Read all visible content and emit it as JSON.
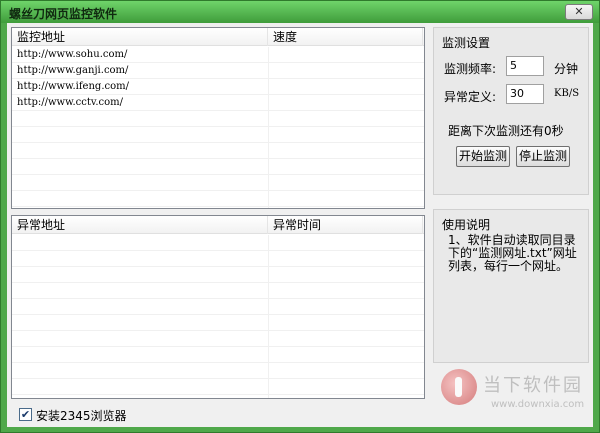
{
  "window": {
    "title": "螺丝刀网页监控软件",
    "close_glyph": "✕"
  },
  "monitor_list": {
    "headers": [
      "监控地址",
      "速度"
    ],
    "rows": [
      [
        "http://www.sohu.com/",
        ""
      ],
      [
        "http://www.ganji.com/",
        ""
      ],
      [
        "http://www.ifeng.com/",
        ""
      ],
      [
        "http://www.cctv.com/",
        ""
      ]
    ]
  },
  "exception_list": {
    "headers": [
      "异常地址",
      "异常时间"
    ],
    "rows": []
  },
  "settings": {
    "title": "监测设置",
    "frequency_label": "监测频率:",
    "frequency_value": "5",
    "frequency_unit": "分钟",
    "exception_label": "异常定义:",
    "exception_value": "30",
    "exception_unit": "KB/S",
    "countdown": "距离下次监测还有0秒",
    "start_button": "开始监测",
    "stop_button": "停止监测"
  },
  "help": {
    "title": "使用说明",
    "text": "1、软件自动读取同目录下的“监测网址.txt”网址列表，每行一个网址。"
  },
  "footer": {
    "checkbox_checked": true,
    "checkbox_label": "安装2345浏览器"
  },
  "watermark": {
    "name": "当下软件园",
    "url": "www.downxia.com"
  }
}
